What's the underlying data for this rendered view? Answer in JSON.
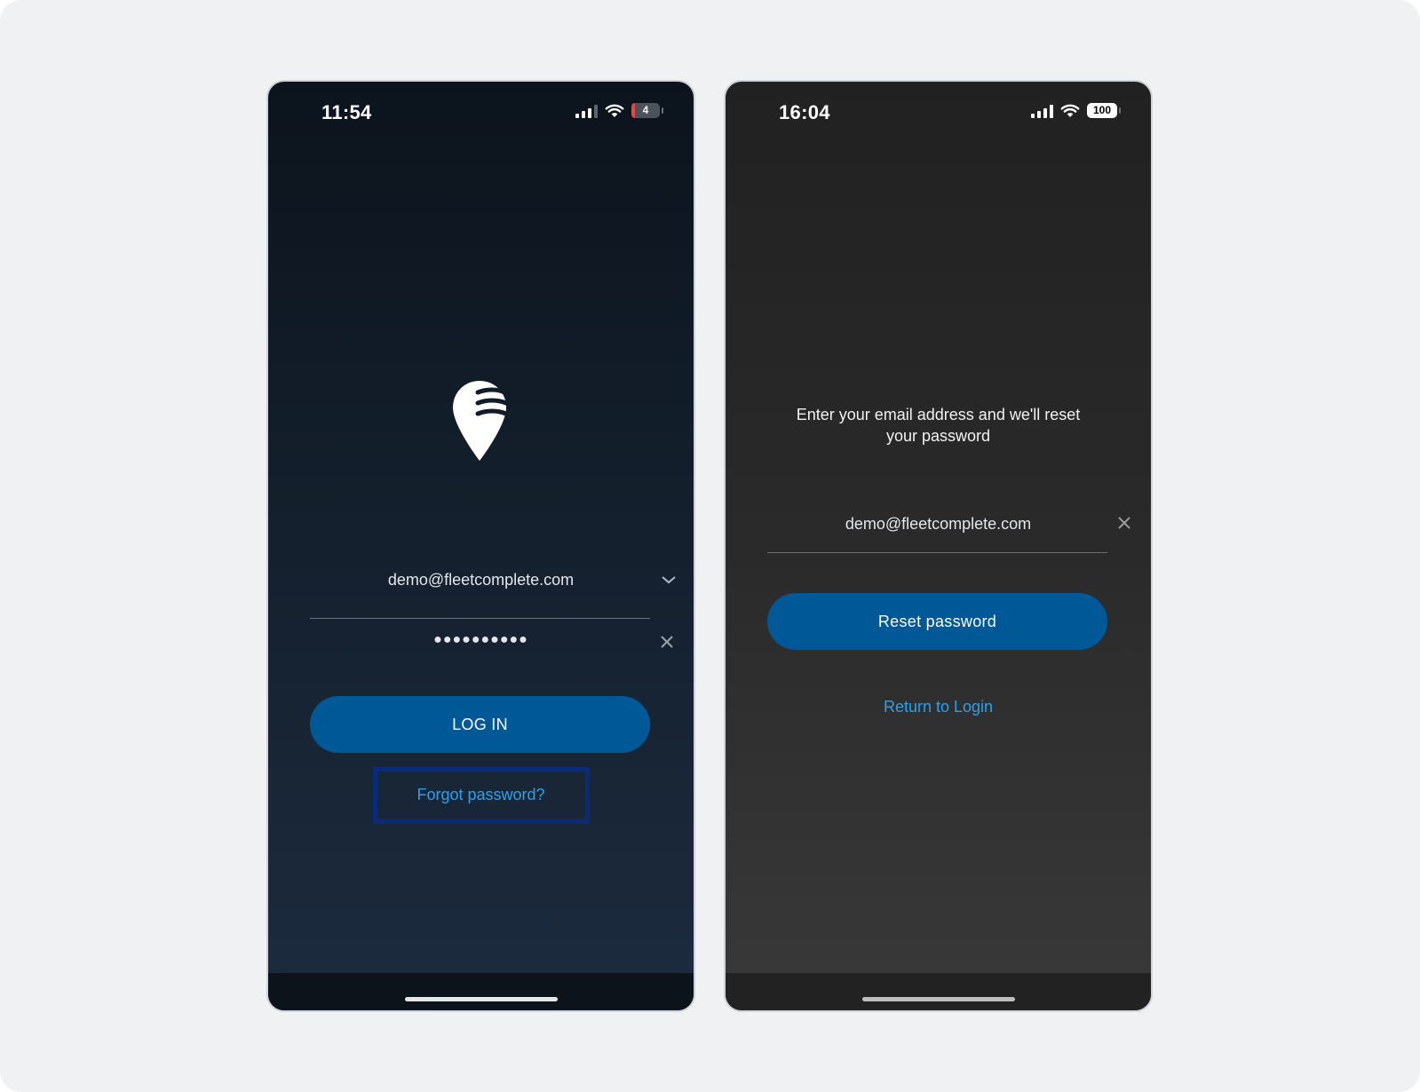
{
  "login_screen": {
    "status_bar": {
      "time": "11:54",
      "battery": "4"
    },
    "email_value": "demo@fleetcomplete.com",
    "password_value": "●●●●●●●●●●",
    "login_label": "LOG IN",
    "forgot_label": "Forgot password?",
    "highlight_color": "#0a2a7a"
  },
  "reset_screen": {
    "status_bar": {
      "time": "16:04",
      "battery": "100"
    },
    "message": "Enter your email address and we'll reset your password",
    "email_value": "demo@fleetcomplete.com",
    "reset_label": "Reset password",
    "return_label": "Return to Login"
  },
  "colors": {
    "accent": "#005896",
    "link": "#2f9fe6"
  },
  "icons": [
    "logo-icon",
    "signal-icon",
    "wifi-icon",
    "battery-icon",
    "chevron-down-icon",
    "close-icon"
  ]
}
